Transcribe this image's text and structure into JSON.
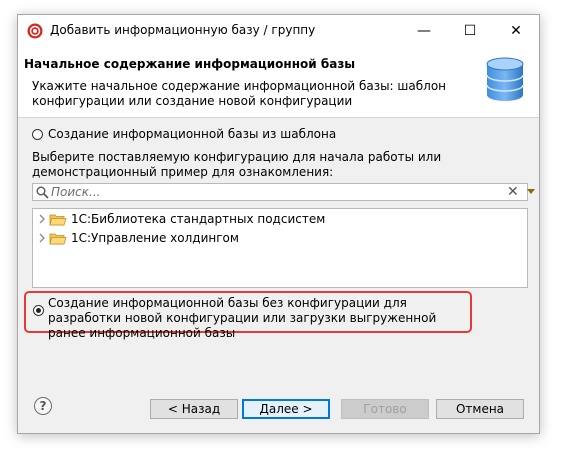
{
  "window": {
    "title": "Добавить информационную базу / группу",
    "controls": {
      "minimize": "—",
      "maximize": "☐",
      "close": "✕"
    }
  },
  "header": {
    "title": "Начальное содержание информационной базы",
    "description": "Укажите начальное содержание информационной базы: шаблон конфигурации или создание новой конфигурации"
  },
  "options": {
    "from_template": {
      "label": "Создание информационной базы из шаблона",
      "selected": false
    },
    "template_hint": "Выберите поставляемую конфигурацию для начала работы или демонстрационный пример для ознакомления:",
    "search": {
      "placeholder": "Поиск...",
      "value": "",
      "clear": "✕"
    },
    "templates": [
      {
        "label": "1С:Библиотека стандартных подсистем"
      },
      {
        "label": "1С:Управление холдингом"
      }
    ],
    "empty_config": {
      "label": "Создание информационной базы без конфигурации для разработки новой конфигурации или загрузки выгруженной ранее информационной базы",
      "selected": true,
      "highlight_color": "#e13b3b"
    }
  },
  "footer": {
    "help": "?",
    "back": "< Назад",
    "next": "Далее >",
    "finish": "Готово",
    "cancel": "Отмена"
  }
}
